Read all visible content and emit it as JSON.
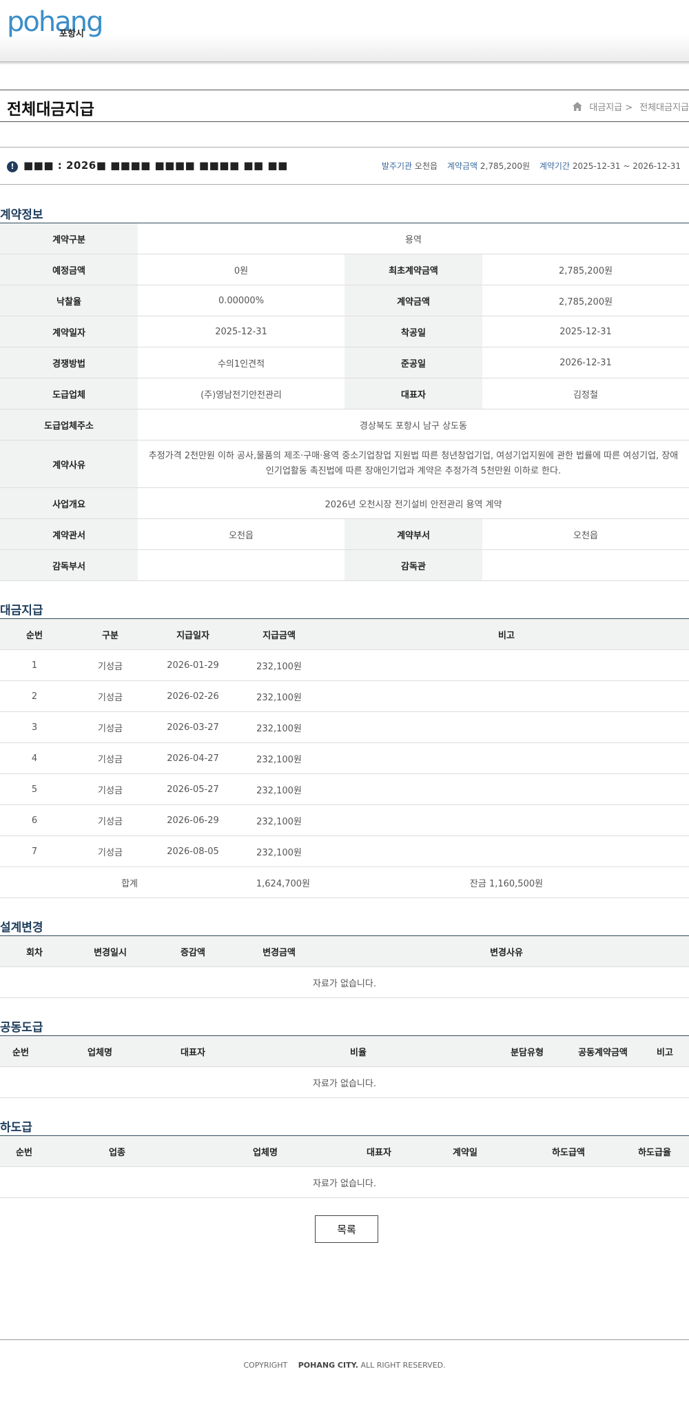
{
  "header": {
    "logo_word": "pohang",
    "logo_sub": "포항시"
  },
  "page": {
    "title": "전체대금지급"
  },
  "breadcrumb": {
    "home_icon": "home-icon",
    "level1": "대금지급 >",
    "level2": "전체대금지급"
  },
  "contract": {
    "name": "■■■ : 2026■ ■■■■ ■■■■ ■■■■ ■■ ■■",
    "agency_label": "발주기관",
    "agency": "오천읍",
    "amount_label": "계약금액",
    "amount": "2,785,200원",
    "period_label": "계약기간",
    "period": "2025-12-31 ~ 2026-12-31"
  },
  "sections": {
    "contract_info": "계약정보",
    "payments": "대금지급",
    "design_change": "설계변경",
    "joint": "공동도급",
    "subcontract": "하도급"
  },
  "contract_info": {
    "type_label": "계약구분",
    "type": "용역",
    "est_label": "예정금액",
    "est": "0원",
    "init_label": "최초계약금액",
    "init": "2,785,200원",
    "rate_label": "낙찰율",
    "rate": "0.00000%",
    "amount_label": "계약금액",
    "amount": "2,785,200원",
    "date_label": "계약일자",
    "date": "2025-12-31",
    "start_label": "착공일",
    "start": "2025-12-31",
    "method_label": "경쟁방법",
    "method": "수의1인견적",
    "end_label": "준공일",
    "end": "2026-12-31",
    "company_label": "도급업체",
    "company": "(주)영남전기안전관리",
    "ceo_label": "대표자",
    "ceo": "김정철",
    "address_label": "도급업체주소",
    "address": "경상북도 포항시 남구 상도동",
    "reason_label": "계약사유",
    "reason": "추정가격 2천만원 이하 공사,물품의 제조·구매·용역 중소기업창업 지원법 따른 청년창업기업, 여성기업지원에 관한 법률에 따른 여성기업, 장애인기업활동 촉진법에 따른 장애인기업과 계약은 추정가격 5천만원 이하로 한다.",
    "overview_label": "사업개요",
    "overview": "2026년 오천시장 전기설비 안전관리 용역 계약",
    "office_label": "계약관서",
    "office": "오천읍",
    "dept_label": "계약부서",
    "dept": "오천읍",
    "supervise_dept_label": "감독부서",
    "supervise_dept": "",
    "supervisor_label": "감독관",
    "supervisor": ""
  },
  "payments": {
    "headers": [
      "순번",
      "구분",
      "지급일자",
      "지급금액",
      "비고"
    ],
    "rows": [
      [
        "1",
        "기성금",
        "2026-01-29",
        "232,100원",
        ""
      ],
      [
        "2",
        "기성금",
        "2026-02-26",
        "232,100원",
        ""
      ],
      [
        "3",
        "기성금",
        "2026-03-27",
        "232,100원",
        ""
      ],
      [
        "4",
        "기성금",
        "2026-04-27",
        "232,100원",
        ""
      ],
      [
        "5",
        "기성금",
        "2026-05-27",
        "232,100원",
        ""
      ],
      [
        "6",
        "기성금",
        "2026-06-29",
        "232,100원",
        ""
      ],
      [
        "7",
        "기성금",
        "2026-08-05",
        "232,100원",
        ""
      ]
    ],
    "total_label": "합계",
    "total": "1,624,700원",
    "balance": "잔금 1,160,500원"
  },
  "design_change": {
    "headers": [
      "회차",
      "변경일시",
      "증감액",
      "변경금액",
      "변경사유"
    ],
    "empty": "자료가 없습니다."
  },
  "joint": {
    "headers": [
      "순번",
      "업체명",
      "대표자",
      "비율",
      "분담유형",
      "공동계약금액",
      "비고"
    ],
    "empty": "자료가 없습니다."
  },
  "subcontract": {
    "headers": [
      "순번",
      "업종",
      "업체명",
      "대표자",
      "계약일",
      "하도급액",
      "하도급율"
    ],
    "empty": "자료가 없습니다."
  },
  "buttons": {
    "list": "목록"
  },
  "footer": {
    "copyright": "COPYRIGHT",
    "org": "POHANG CITY.",
    "rights": "ALL RIGHT RESERVED."
  }
}
